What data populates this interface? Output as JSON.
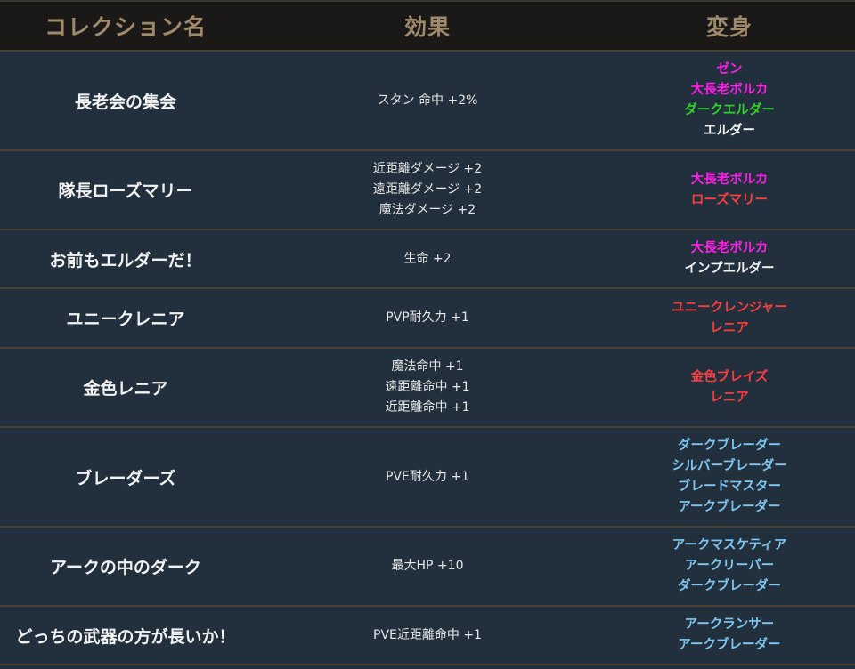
{
  "header": {
    "col_name": "コレクション名",
    "col_effect": "効果",
    "col_transform": "変身"
  },
  "colors": {
    "magenta": "#ff1ee8",
    "green": "#34d12c",
    "white": "#f2f2f2",
    "red": "#ff3c3c",
    "blue": "#7ec6f0"
  },
  "rows": [
    {
      "name": "長老会の集会",
      "effects": [
        "スタン 命中 +2%"
      ],
      "transforms": [
        {
          "label": "ゼン",
          "color": "#ff1ee8"
        },
        {
          "label": "大長老ボルカ",
          "color": "#ff1ee8"
        },
        {
          "label": "ダークエルダー",
          "color": "#34d12c"
        },
        {
          "label": "エルダー",
          "color": "#f2f2f2"
        }
      ]
    },
    {
      "name": "隊長ローズマリー",
      "effects": [
        "近距離ダメージ +2",
        "遠距離ダメージ +2",
        "魔法ダメージ +2"
      ],
      "transforms": [
        {
          "label": "大長老ボルカ",
          "color": "#ff1ee8"
        },
        {
          "label": "ローズマリー",
          "color": "#ff3c3c"
        }
      ]
    },
    {
      "name": "お前もエルダーだ！",
      "effects": [
        "生命 +2"
      ],
      "transforms": [
        {
          "label": "大長老ボルカ",
          "color": "#ff1ee8"
        },
        {
          "label": "インプエルダー",
          "color": "#f2f2f2"
        }
      ]
    },
    {
      "name": "ユニークレニア",
      "effects": [
        "PVP耐久力 +1"
      ],
      "transforms": [
        {
          "label": "ユニークレンジャー",
          "color": "#ff3c3c"
        },
        {
          "label": "レニア",
          "color": "#ff3c3c"
        }
      ]
    },
    {
      "name": "金色レニア",
      "effects": [
        "魔法命中 +1",
        "遠距離命中 +1",
        "近距離命中 +1"
      ],
      "transforms": [
        {
          "label": "金色ブレイズ",
          "color": "#ff3c3c"
        },
        {
          "label": "レニア",
          "color": "#ff3c3c"
        }
      ]
    },
    {
      "name": "ブレーダーズ",
      "effects": [
        "PVE耐久力 +1"
      ],
      "transforms": [
        {
          "label": "ダークブレーダー",
          "color": "#7ec6f0"
        },
        {
          "label": "シルバーブレーダー",
          "color": "#7ec6f0"
        },
        {
          "label": "ブレードマスター",
          "color": "#7ec6f0"
        },
        {
          "label": "アークブレーダー",
          "color": "#7ec6f0"
        }
      ]
    },
    {
      "name": "アークの中のダーク",
      "effects": [
        "最大HP +10"
      ],
      "transforms": [
        {
          "label": "アークマスケティア",
          "color": "#7ec6f0"
        },
        {
          "label": "アークリーパー",
          "color": "#7ec6f0"
        },
        {
          "label": "ダークブレーダー",
          "color": "#7ec6f0"
        }
      ]
    },
    {
      "name": "どっちの武器の方が長いか！",
      "effects": [
        "PVE近距離命中 +1"
      ],
      "transforms": [
        {
          "label": "アークランサー",
          "color": "#7ec6f0"
        },
        {
          "label": "アークブレーダー",
          "color": "#7ec6f0"
        }
      ]
    }
  ]
}
